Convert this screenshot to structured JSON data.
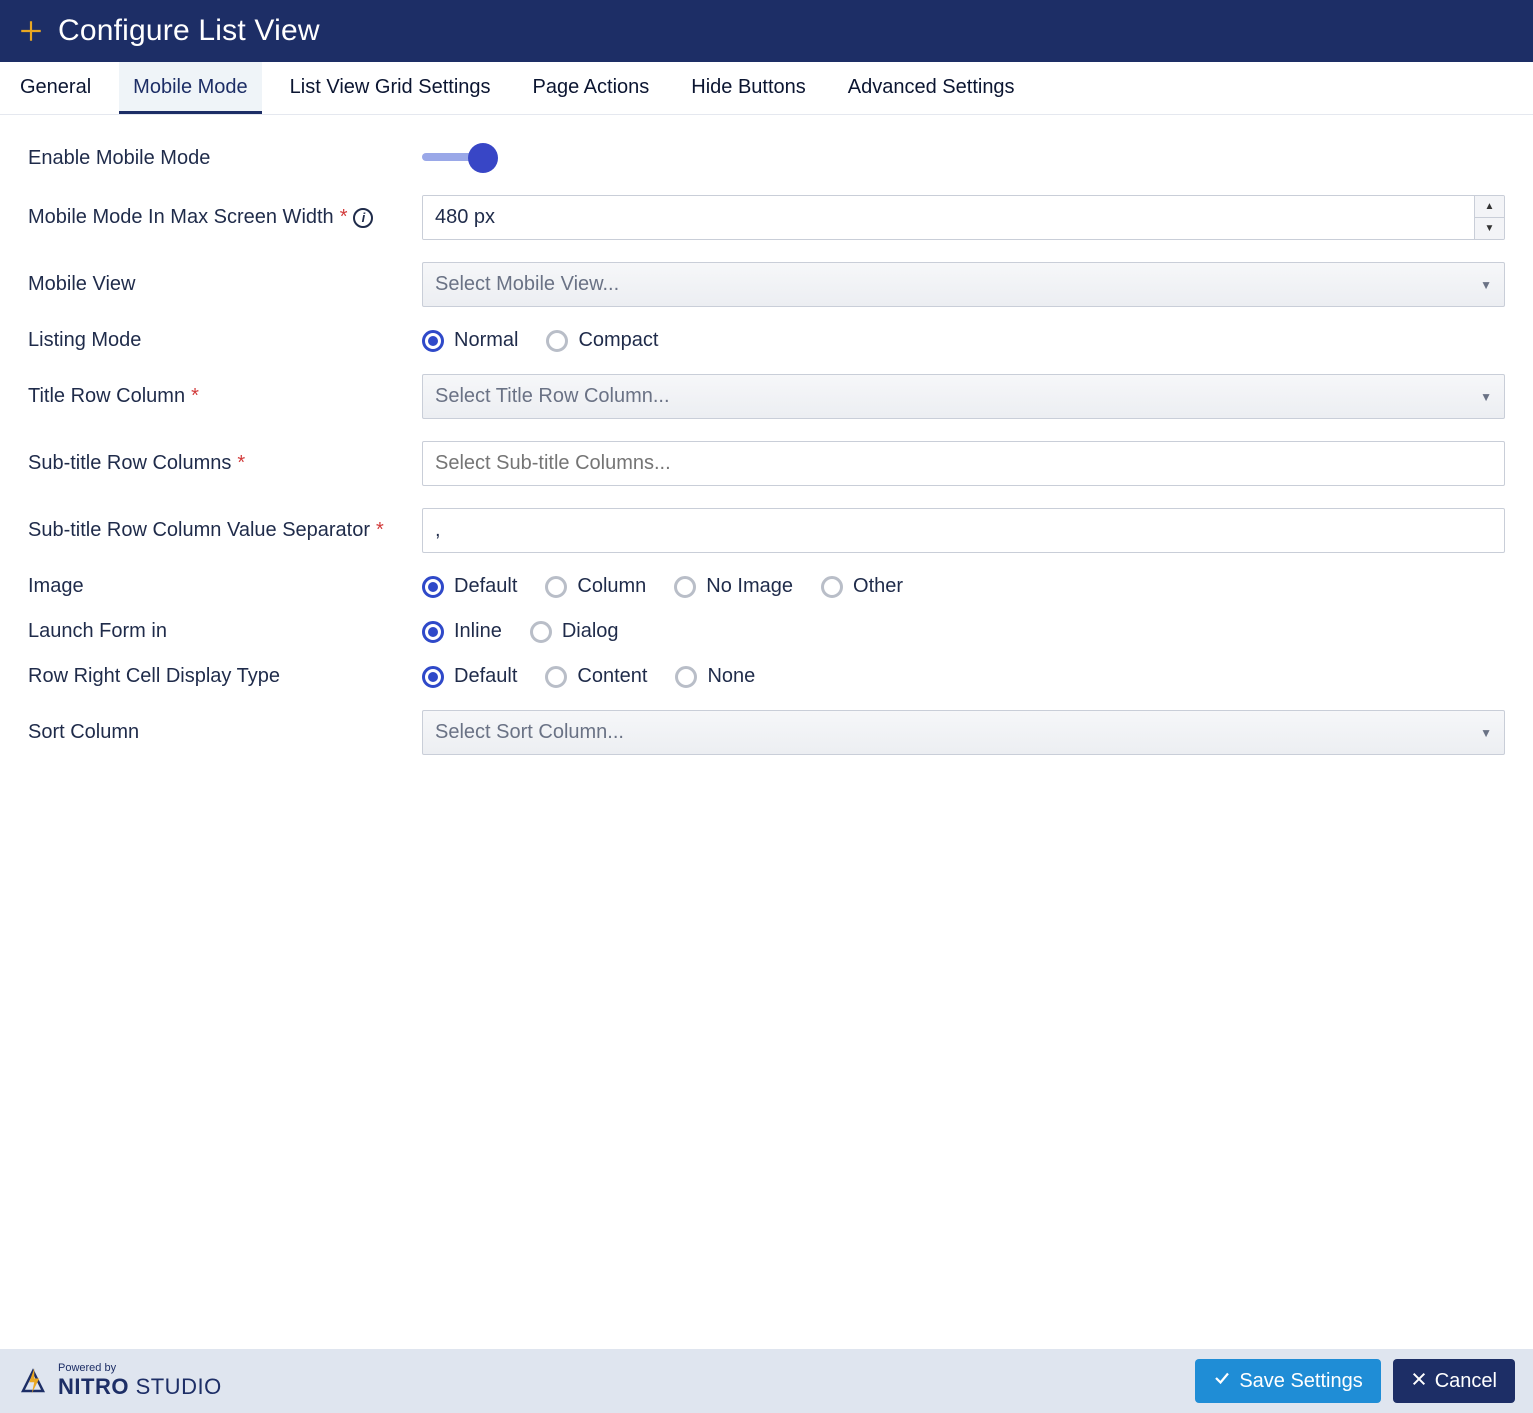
{
  "header": {
    "title": "Configure List View"
  },
  "tabs": [
    {
      "label": "General",
      "active": false
    },
    {
      "label": "Mobile Mode",
      "active": true
    },
    {
      "label": "List View Grid Settings",
      "active": false
    },
    {
      "label": "Page Actions",
      "active": false
    },
    {
      "label": "Hide Buttons",
      "active": false
    },
    {
      "label": "Advanced Settings",
      "active": false
    }
  ],
  "form": {
    "enable_label": "Enable Mobile Mode",
    "enable_value": true,
    "max_width_label": "Mobile Mode In Max Screen Width",
    "max_width_required": true,
    "max_width_value": "480 px",
    "mobile_view_label": "Mobile View",
    "mobile_view_placeholder": "Select Mobile View...",
    "listing_mode_label": "Listing Mode",
    "listing_mode": {
      "options": [
        "Normal",
        "Compact"
      ],
      "selected": "Normal"
    },
    "title_col_label": "Title Row Column",
    "title_col_required": true,
    "title_col_placeholder": "Select Title Row Column...",
    "subtitle_cols_label": "Sub-title Row Columns",
    "subtitle_cols_required": true,
    "subtitle_cols_placeholder": "Select Sub-title Columns...",
    "separator_label": "Sub-title Row Column Value Separator",
    "separator_required": true,
    "separator_value": ",",
    "image_label": "Image",
    "image": {
      "options": [
        "Default",
        "Column",
        "No Image",
        "Other"
      ],
      "selected": "Default"
    },
    "launch_label": "Launch Form in",
    "launch": {
      "options": [
        "Inline",
        "Dialog"
      ],
      "selected": "Inline"
    },
    "row_right_label": "Row Right Cell Display Type",
    "row_right": {
      "options": [
        "Default",
        "Content",
        "None"
      ],
      "selected": "Default"
    },
    "sort_label": "Sort Column",
    "sort_placeholder": "Select Sort Column..."
  },
  "footer": {
    "powered": "Powered by",
    "brand": "NITRO",
    "brand_light": " STUDIO",
    "save": "Save Settings",
    "cancel": "Cancel"
  }
}
